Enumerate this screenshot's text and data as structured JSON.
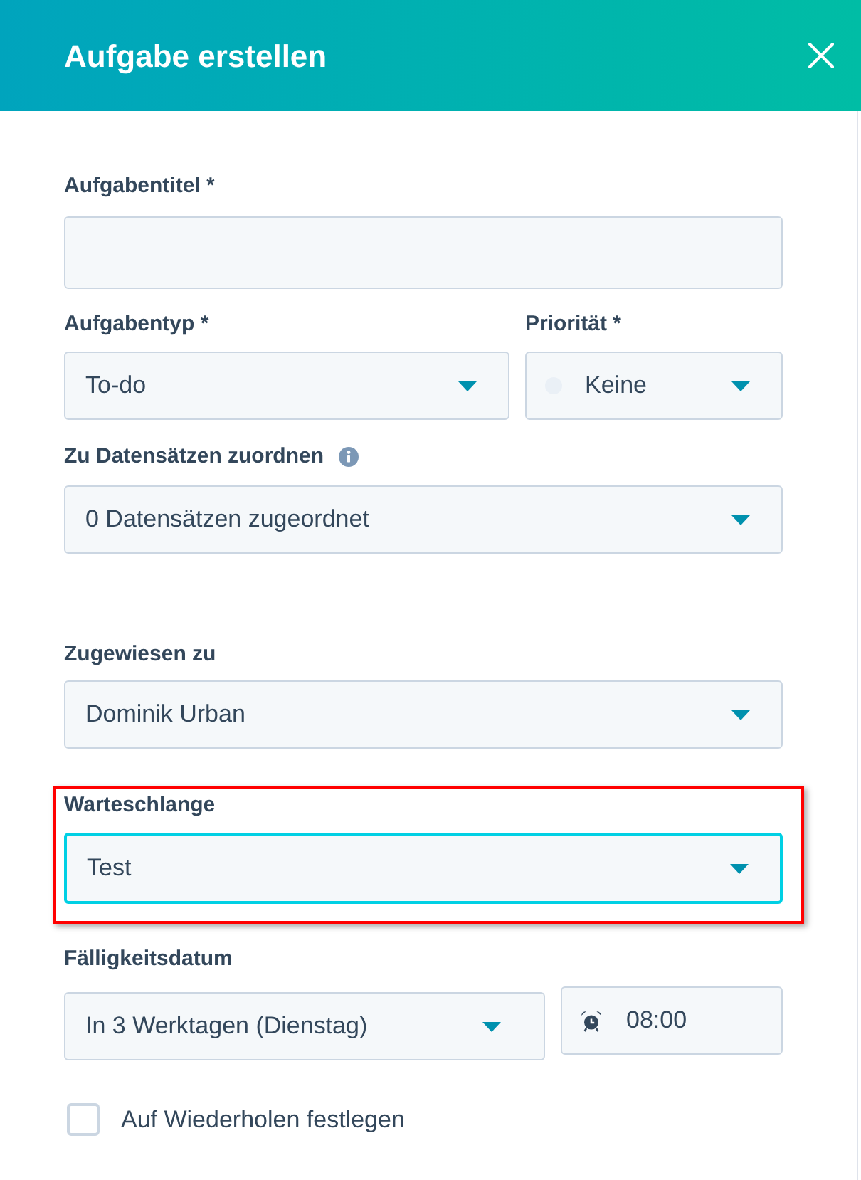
{
  "dialog": {
    "title": "Aufgabe erstellen"
  },
  "task_title": {
    "label": "Aufgabentitel *"
  },
  "task_type": {
    "label": "Aufgabentyp *",
    "value": "To-do"
  },
  "priority": {
    "label": "Priorität *",
    "value": "Keine"
  },
  "records": {
    "label": "Zu Datensätzen zuordnen",
    "value": "0 Datensätzen zugeordnet"
  },
  "assigned_to": {
    "label": "Zugewiesen zu",
    "value": "Dominik Urban"
  },
  "queue": {
    "label": "Warteschlange",
    "value": "Test",
    "focused": true,
    "highlighted": true
  },
  "due_date": {
    "label": "Fälligkeitsdatum",
    "date": "In 3 Werktagen (Dienstag)",
    "time": "08:00"
  },
  "repeat": {
    "label": "Auf Wiederholen festlegen",
    "checked": false
  }
}
